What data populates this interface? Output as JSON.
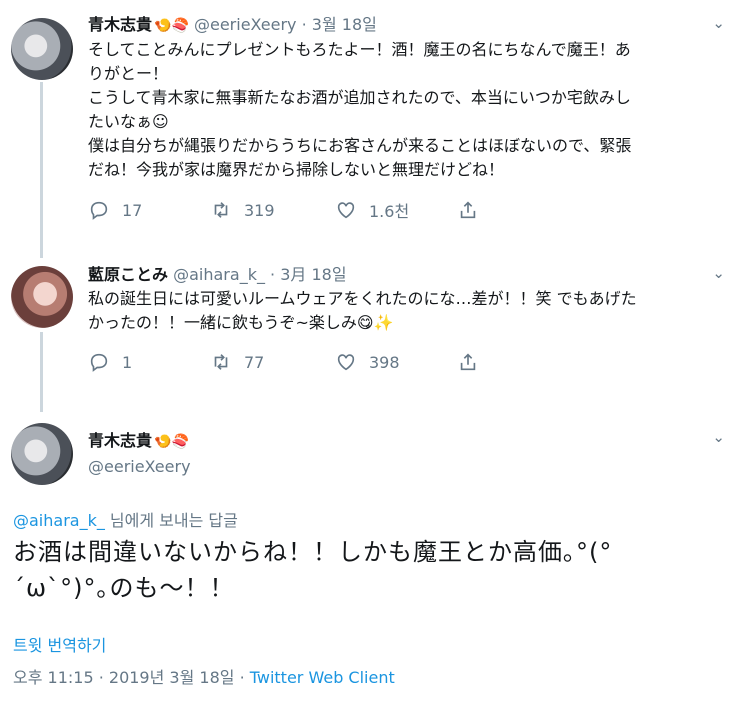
{
  "tweet1": {
    "name": "青木志貴",
    "emojis": "🍤🍣",
    "handle": "@eerieXeery",
    "sep": "·",
    "date": "3월 18일",
    "lines": [
      "そしてことみんにプレゼントもろたよー！酒！魔王の名にちなんで魔王！あ",
      "りがとー！",
      "こうして青木家に無事新たなお酒が追加されたので、本当にいつか宅飲みし",
      "たいなぁ☺",
      "僕は自分ちが縄張りだからうちにお客さんが来ることはほぼないので、緊張",
      "だね！今我が家は魔界だから掃除しないと無理だけどね！"
    ],
    "replies": "17",
    "retweets": "319",
    "likes": "1.6천"
  },
  "tweet2": {
    "name": "藍原ことみ",
    "handle": "@aihara_k_",
    "sep": "·",
    "date": "3月 18일",
    "lines": [
      "私の誕生日には可愛いルームウェアをくれたのにな…差が！！笑 でもあげた",
      "かったの！！一緒に飲もうぞ~楽しみ😋✨"
    ],
    "replies": "1",
    "retweets": "77",
    "likes": "398"
  },
  "focus": {
    "name": "青木志貴",
    "emojis": "🍤🍣",
    "handle": "@eerieXeery",
    "reply_handle": "@aihara_k_",
    "reply_suffix": " 님에게 보내는 답글",
    "text_lines": [
      "お酒は間違いないからね！！しかも魔王とか高価｡°(°",
      "´ω`°)°｡のも～！！"
    ],
    "translate": "트윗 번역하기",
    "time": "오후 11:15 · 2019년 3월 18일 · ",
    "client": "Twitter Web Client"
  },
  "icons": [
    "avatar",
    "chevron-down-icon",
    "reply-icon",
    "retweet-icon",
    "like-icon",
    "share-icon"
  ],
  "colors": {
    "link": "#1b95e0",
    "muted": "#657786",
    "thread": "#ccd6dd"
  }
}
